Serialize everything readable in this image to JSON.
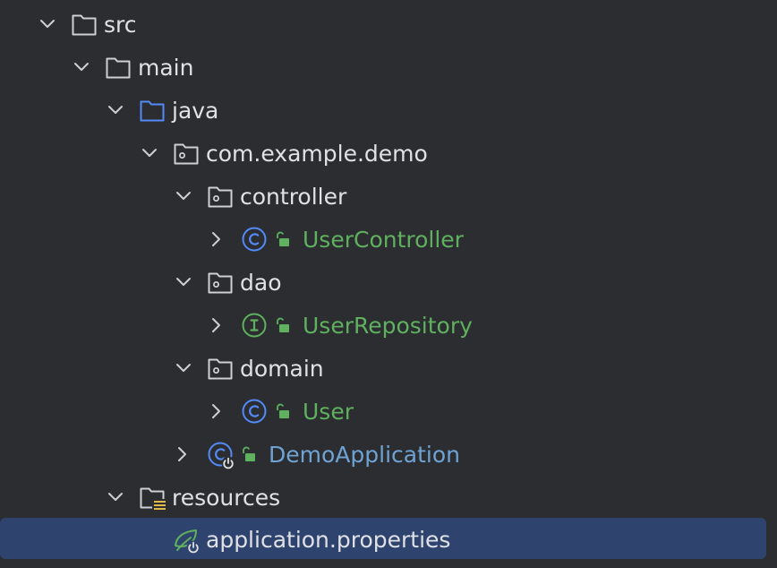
{
  "project_tree": {
    "src": {
      "label": "src"
    },
    "main": {
      "label": "main"
    },
    "java": {
      "label": "java"
    },
    "package": {
      "label": "com.example.demo"
    },
    "controller": {
      "label": "controller"
    },
    "user_controller": {
      "label": "UserController",
      "kind": "class",
      "icon": "class-icon"
    },
    "dao": {
      "label": "dao"
    },
    "user_repository": {
      "label": "UserRepository",
      "kind": "interface",
      "icon": "interface-icon"
    },
    "domain": {
      "label": "domain"
    },
    "user": {
      "label": "User",
      "kind": "class",
      "icon": "class-icon"
    },
    "demo_application": {
      "label": "DemoApplication",
      "kind": "spring-boot-application",
      "icon": "spring-boot-class-icon"
    },
    "resources": {
      "label": "resources"
    },
    "application_properties": {
      "label": "application.properties",
      "icon": "spring-properties-icon",
      "selected": true
    }
  },
  "colors": {
    "background": "#2b2d30",
    "text": "#dfe1e5",
    "class_name_green": "#5fb05f",
    "app_name_blue": "#6fa3d4",
    "selection": "#2e436e",
    "class_icon_blue": "#548af7",
    "interface_icon_green": "#5fb05f",
    "folder_outline": "#ced0d6",
    "source_folder_blue": "#548af7",
    "resources_marker": "#e0b84c"
  }
}
